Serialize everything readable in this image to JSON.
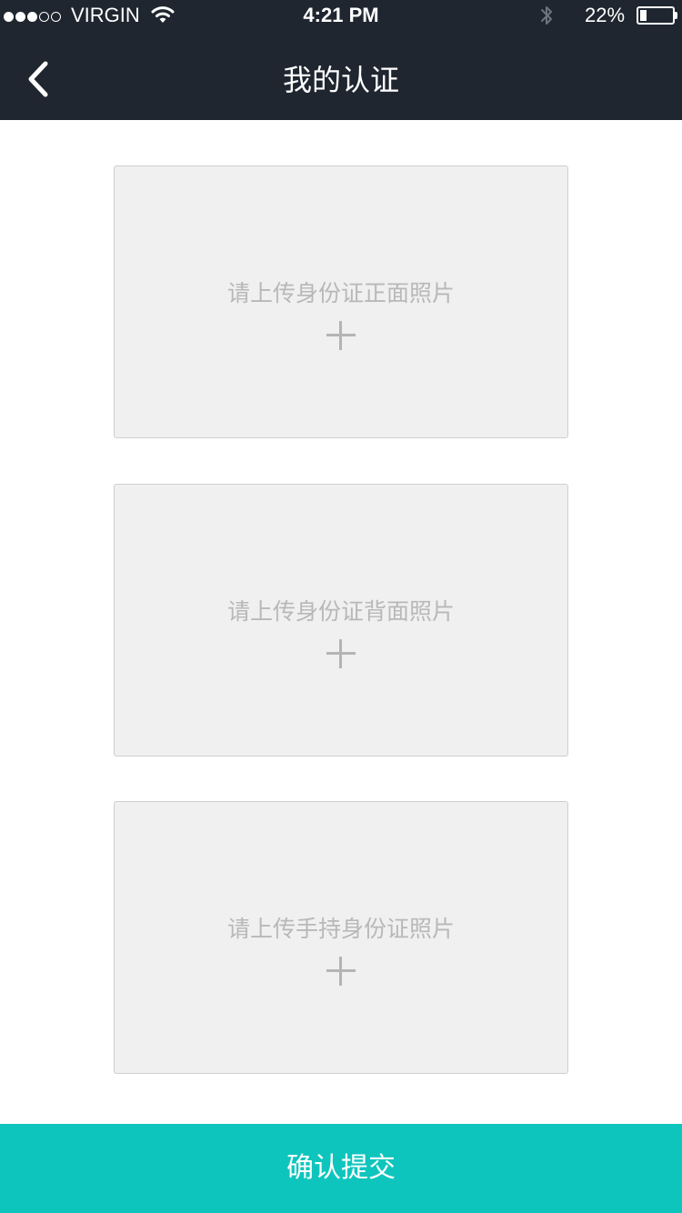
{
  "status_bar": {
    "signal_full": 3,
    "signal_total": 5,
    "carrier": "VIRGIN",
    "time": "4:21 PM",
    "battery_percent": "22%",
    "battery_level": 0.22,
    "icons": [
      "wifi-icon",
      "bluetooth-icon",
      "battery-icon"
    ]
  },
  "header": {
    "back_icon": "chevron-left-icon",
    "title": "我的认证",
    "background_color": "#1f2630"
  },
  "uploads": [
    {
      "label": "请上传身份证正面照片",
      "icon": "plus-icon"
    },
    {
      "label": "请上传身份证背面照片",
      "icon": "plus-icon"
    },
    {
      "label": "请上传手持身份证照片",
      "icon": "plus-icon"
    }
  ],
  "submit": {
    "label": "确认提交",
    "color": "#0ec5bd"
  }
}
